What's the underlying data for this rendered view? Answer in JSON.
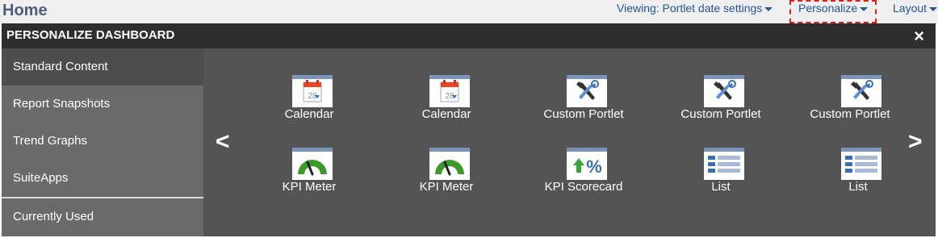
{
  "header": {
    "title": "Home",
    "viewing_label": "Viewing: Portlet date settings",
    "personalize_label": "Personalize",
    "layout_label": "Layout"
  },
  "panel": {
    "title": "PERSONALIZE DASHBOARD",
    "close_symbol": "×",
    "prev_symbol": "<",
    "next_symbol": ">"
  },
  "sidebar": {
    "items": [
      {
        "label": "Standard Content",
        "active": true
      },
      {
        "label": "Report Snapshots"
      },
      {
        "label": "Trend Graphs"
      },
      {
        "label": "SuiteApps"
      },
      {
        "label": "Currently Used"
      }
    ]
  },
  "tiles": [
    {
      "label": "Calendar",
      "icon": "calendar-icon",
      "calendar_day": "28"
    },
    {
      "label": "Calendar",
      "icon": "calendar-icon",
      "calendar_day": "28"
    },
    {
      "label": "Custom Portlet",
      "icon": "tools-icon"
    },
    {
      "label": "Custom Portlet",
      "icon": "tools-icon"
    },
    {
      "label": "Custom Portlet",
      "icon": "tools-icon"
    },
    {
      "label": "KPI Meter",
      "icon": "gauge-icon"
    },
    {
      "label": "KPI Meter",
      "icon": "gauge-icon"
    },
    {
      "label": "KPI Scorecard",
      "icon": "scorecard-icon",
      "scorecard_symbol": "%"
    },
    {
      "label": "List",
      "icon": "list-icon"
    },
    {
      "label": "List",
      "icon": "list-icon"
    }
  ],
  "colors": {
    "header_text": "#4d5f79",
    "link": "#255599",
    "highlight_border": "#e31b1b",
    "panel_bg": "#545454",
    "panel_header_bg": "#2e2e2e",
    "sidebar_bg": "#6a6a6a",
    "sidebar_active_bg": "#4d4d4d",
    "gauge_green": "#3b9a2a",
    "arrow_green": "#3aa335",
    "calendar_red": "#e8462a"
  }
}
